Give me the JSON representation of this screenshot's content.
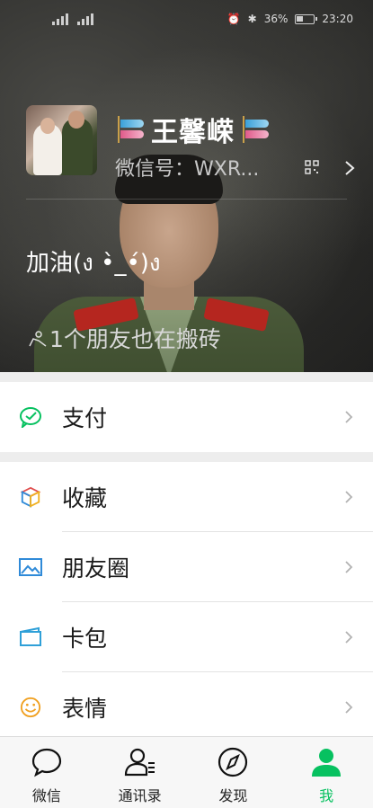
{
  "status_bar": {
    "signal1": "4G",
    "signal2": "4G",
    "battery": "36%",
    "time": "23:20"
  },
  "profile": {
    "name": "王馨嵘",
    "wechat_id": "微信号：WXR...",
    "status": "加油(ง •̀_•́)ง",
    "friends_status": "1个朋友也在搬砖"
  },
  "menu": {
    "pay": "支付",
    "favorites": "收藏",
    "moments": "朋友圈",
    "cards": "卡包",
    "stickers": "表情"
  },
  "tabs": [
    {
      "label": "微信",
      "icon": "chat-bubble-icon"
    },
    {
      "label": "通讯录",
      "icon": "contacts-icon"
    },
    {
      "label": "发现",
      "icon": "compass-icon"
    },
    {
      "label": "我",
      "icon": "person-icon"
    }
  ],
  "colors": {
    "accent": "#07c160",
    "pay_icon": "#07c160",
    "moments_icon": "#2f8ad8",
    "cards_icon": "#2fa0d8",
    "stickers_icon": "#f0a020"
  }
}
